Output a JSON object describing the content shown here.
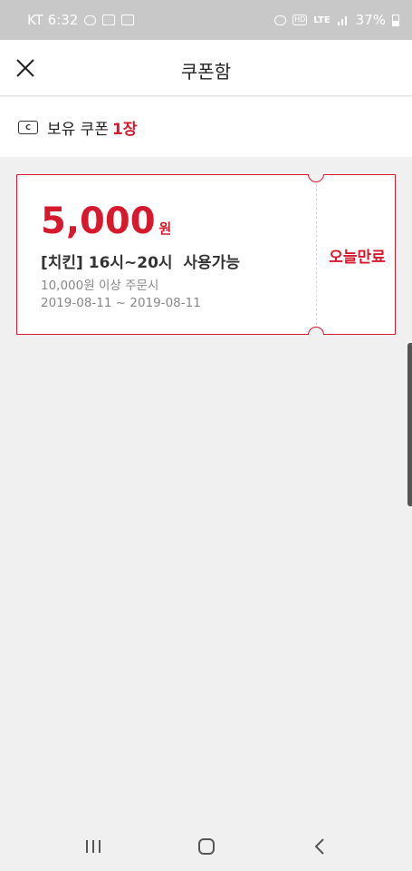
{
  "status_bar": {
    "carrier_time": "KT 6:32",
    "network": "LTE",
    "battery": "37%"
  },
  "header": {
    "title": "쿠폰함",
    "close_icon": "close-icon"
  },
  "summary": {
    "icon": "coupon-icon",
    "icon_glyph": "C",
    "label": "보유 쿠폰",
    "count": "1장"
  },
  "coupons": [
    {
      "amount": "5,000",
      "unit": "원",
      "name": "[치킨] 16시~20시  사용가능",
      "condition": "10,000원 이상 주문시",
      "period": "2019-08-11 ~ 2019-08-11",
      "expire_label": "오늘만료"
    }
  ],
  "colors": {
    "accent": "#d6192c",
    "background": "#f0f0f0",
    "status_bar": "#c8c8c8"
  },
  "nav": {
    "recent_icon": "recent-apps-icon",
    "home_icon": "home-icon",
    "back_icon": "back-icon"
  }
}
